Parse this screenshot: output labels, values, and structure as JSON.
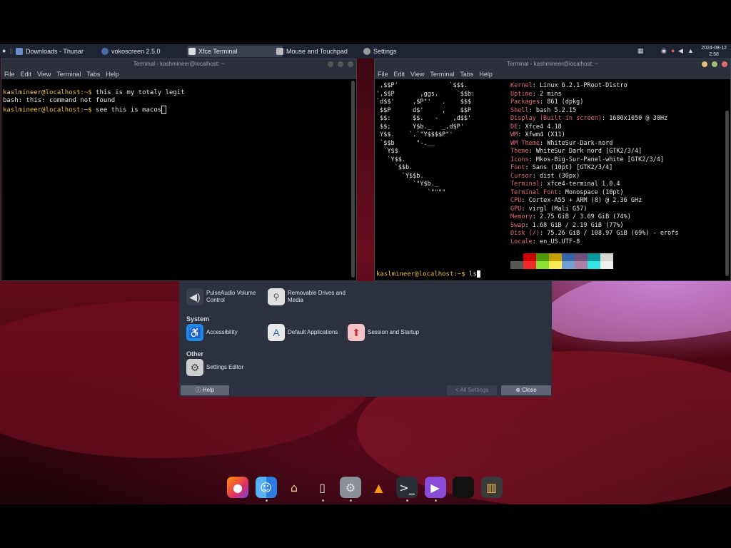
{
  "taskbar": {
    "items": [
      "Downloads - Thunar",
      "vokoscreen 2.5.0",
      "Xfce Terminal",
      "Mouse and Touchpad",
      "Settings"
    ],
    "clock_date": "2024-08-12",
    "clock_time": "2:58"
  },
  "left_terminal": {
    "title": "Terminal - kashmineer@localhost: ~",
    "menu": [
      "File",
      "Edit",
      "View",
      "Terminal",
      "Tabs",
      "Help"
    ],
    "lines": [
      {
        "prompt": "kaslmineer@localhost:~$",
        "text": " this is my totaly legit"
      },
      {
        "prompt": "",
        "text": "bash: this: command not found"
      },
      {
        "prompt": "kaslmineer@localhost:~$",
        "text": " see this is macos"
      }
    ]
  },
  "right_terminal": {
    "title": "Terminal - kashmineer@localhost: ~",
    "menu": [
      "File",
      "Edit",
      "View",
      "Terminal",
      "Tabs",
      "Help"
    ],
    "logo": [
      " ,$$P'              `$$$.",
      "',$$P       ,ggs.     `$$b:",
      "`d$$'     ,$P\"'   .    $$$",
      " $$P      d$'     ,    $$P",
      " $$:      $$.   -    ,d$$'",
      " $$;      Y$b._   _,d$P'",
      " Y$$.    `.`\"Y$$$$P\"'",
      " `$$b      \"-.__",
      "  `Y$$",
      "   `Y$$.",
      "     `$$b.",
      "       `Y$$b.",
      "          `\"Y$b._",
      "              `\"\"\"\""
    ],
    "info": [
      {
        "key": "Kernel",
        "value": "Linux 6.2.1-PRoot-Distro"
      },
      {
        "key": "Uptime",
        "value": "2 mins"
      },
      {
        "key": "Packages",
        "value": "861 (dpkg)"
      },
      {
        "key": "Shell",
        "value": "bash 5.2.15"
      },
      {
        "key": "Display (Built-in screen)",
        "value": "1680x1050 @ 30Hz"
      },
      {
        "key": "DE",
        "value": "Xfce4 4.18"
      },
      {
        "key": "WM",
        "value": "Xfwm4 (X11)"
      },
      {
        "key": "WM Theme",
        "value": "WhiteSur-Dark-nord"
      },
      {
        "key": "Theme",
        "value": "WhiteSur Dark nord [GTK2/3/4]"
      },
      {
        "key": "Icons",
        "value": "Mkos-Big-Sur-Panel-white [GTK2/3/4]"
      },
      {
        "key": "Font",
        "value": "Sans (10pt) [GTK2/3/4]"
      },
      {
        "key": "Cursor",
        "value": "dist (30px)"
      },
      {
        "key": "Terminal",
        "value": "xfce4-terminal 1.0.4"
      },
      {
        "key": "Terminal Font",
        "value": "Monospace (10pt)"
      },
      {
        "key": "CPU",
        "value": "Cortex-A55 + ARM (8) @ 2.36 GHz"
      },
      {
        "key": "GPU",
        "value": "virgl (Mali G57)"
      },
      {
        "key": "Memory",
        "value": "2.75 GiB / 3.69 GiB (74%)"
      },
      {
        "key": "Swap",
        "value": "1.68 GiB / 2.19 GiB (77%)"
      },
      {
        "key": "Disk (/)",
        "value": "75.26 GiB / 108.97 GiB (69%) - erofs"
      },
      {
        "key": "Locale",
        "value": "en_US.UTF-8"
      }
    ],
    "prompt": "kaslmineer@localhost:~$",
    "command": " ls",
    "palette_top": [
      "#000000",
      "#cc0000",
      "#4e9a06",
      "#c4a000",
      "#3465a4",
      "#75507b",
      "#06989a",
      "#d3d7cf"
    ],
    "palette_bottom": [
      "#555753",
      "#ef2929",
      "#8ae234",
      "#fce94f",
      "#729fcf",
      "#ad7fa8",
      "#34e2e2",
      "#eeeeec"
    ]
  },
  "settings": {
    "items_top": [
      "PulseAudio Volume Control",
      "Removable Drives and Media"
    ],
    "section_system": "System",
    "system_items": [
      "Accessibility",
      "Default Applications",
      "Session and Startup"
    ],
    "section_other": "Other",
    "other_items": [
      "Settings Editor"
    ],
    "help_label": "Help",
    "all_settings_label": "All Settings",
    "close_label": "Close"
  },
  "dock": {
    "icons": [
      "firefox-icon",
      "finder-icon",
      "home-folder-icon",
      "mouse-icon",
      "settings-icon",
      "vlc-icon",
      "terminal-icon",
      "video-recorder-icon",
      "blank-app-icon",
      "file-manager-icon"
    ]
  }
}
